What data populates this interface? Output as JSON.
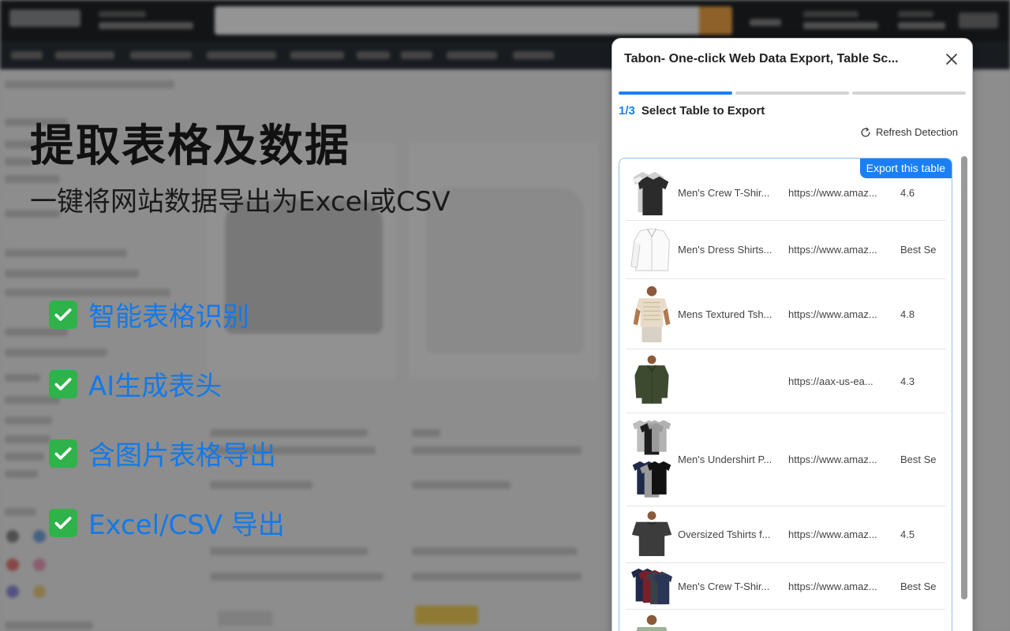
{
  "promo": {
    "title": "提取表格及数据",
    "subtitle": "一键将网站数据导出为Excel或CSV",
    "features": [
      "智能表格识别",
      "AI生成表头",
      "含图片表格导出",
      "Excel/CSV 导出"
    ]
  },
  "panel": {
    "title": "Tabon- One-click Web Data Export, Table Sc...",
    "step_count": "1/3",
    "step_label": "Select Table to Export",
    "refresh_label": "Refresh Detection",
    "export_badge": "Export this table",
    "progress_step": 1,
    "progress_total": 3,
    "rows": [
      {
        "name": "Men's Crew T-Shir...",
        "url": "https://www.amaz...",
        "rating": "4.6"
      },
      {
        "name": "Men's Dress Shirts...",
        "url": "https://www.amaz...",
        "rating": "Best Se"
      },
      {
        "name": "Mens Textured Tsh...",
        "url": "https://www.amaz...",
        "rating": "4.8"
      },
      {
        "name": "",
        "url": "https://aax-us-ea...",
        "rating": "4.3"
      },
      {
        "name": "Men's Undershirt P...",
        "url": "https://www.amaz...",
        "rating": "Best Se"
      },
      {
        "name": "Oversized Tshirts f...",
        "url": "https://www.amaz...",
        "rating": "4.5"
      },
      {
        "name": "Men's Crew T-Shir...",
        "url": "https://www.amaz...",
        "rating": "Best Se"
      }
    ]
  },
  "colors": {
    "accent": "#1a7ff5",
    "feature_text": "#1479e8",
    "check": "#2fb24a"
  }
}
